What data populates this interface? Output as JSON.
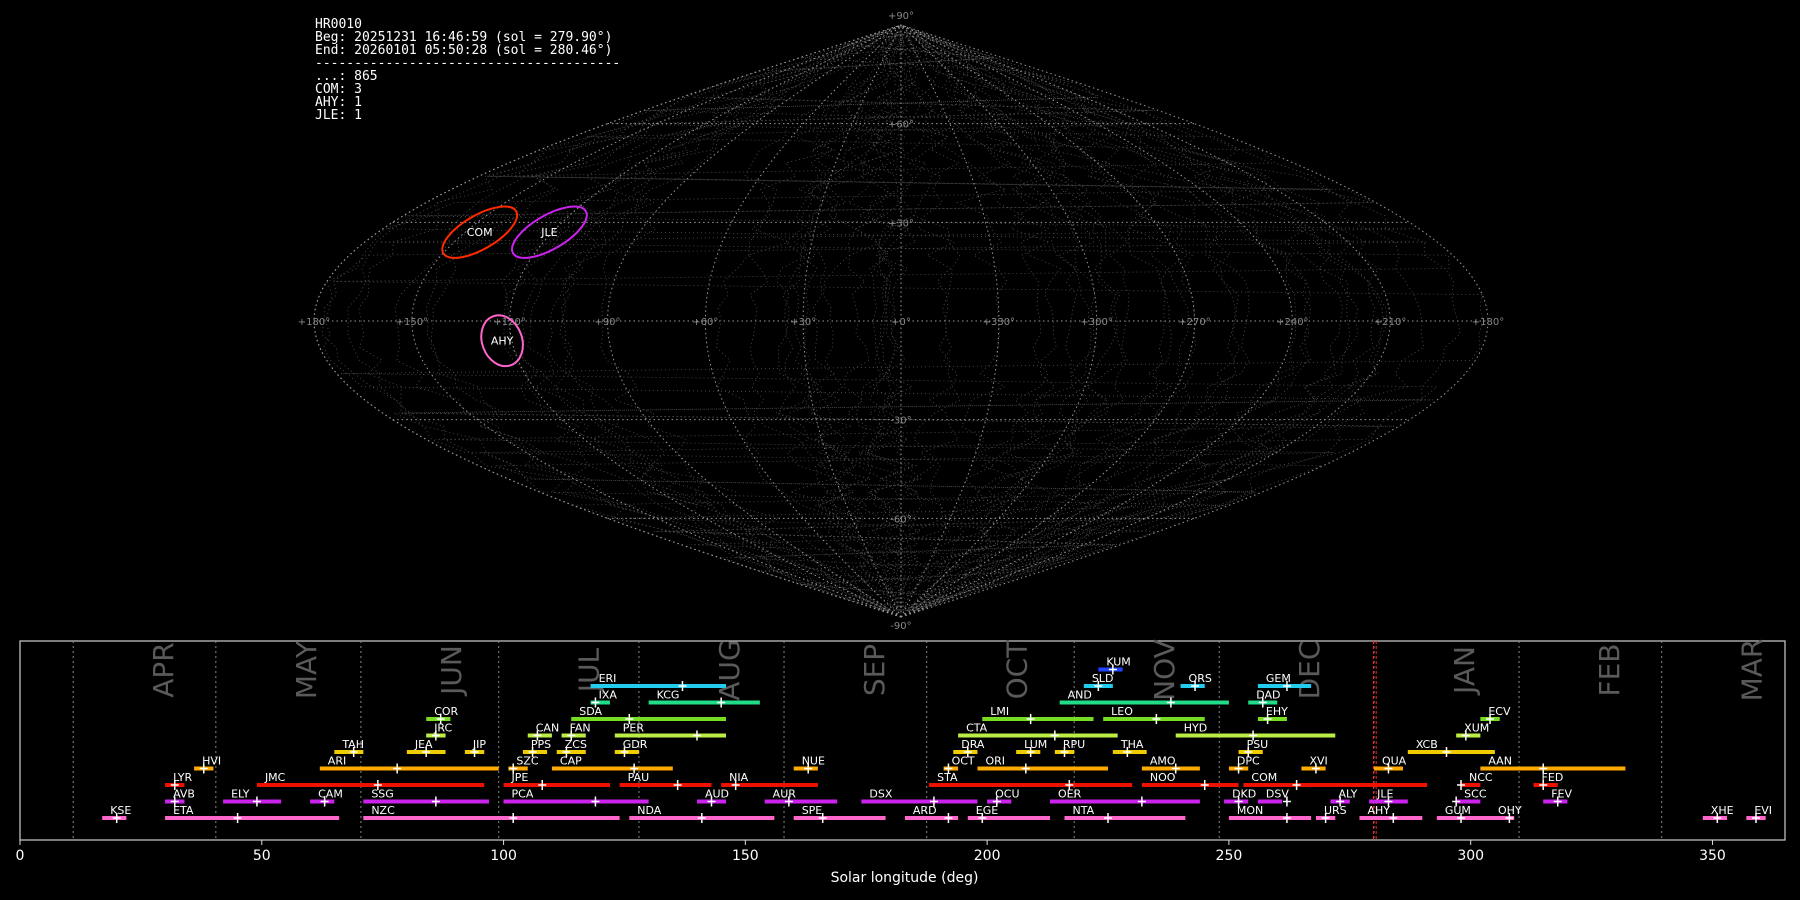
{
  "info": {
    "lines": [
      "HR0010",
      "Beg: 20251231 16:46:59 (sol = 279.90°)",
      "End: 20260101 05:50:28 (sol = 280.46°)",
      "---------------------------------------",
      "...: 865",
      "COM: 3",
      "AHY: 1",
      "JLE: 1"
    ]
  },
  "sky_map": {
    "projection": "sinusoidal",
    "lon_labels": [
      "+180°",
      "+150°",
      "+120°",
      "+90°",
      "+60°",
      "+30°",
      "+0°",
      "+330°",
      "+300°",
      "+270°",
      "+240°",
      "+210°",
      "+180°"
    ],
    "lat_labels": [
      "+90°",
      "+60°",
      "+30°",
      "-30°",
      "-60°",
      "-90°"
    ],
    "radiants": [
      {
        "code": "COM",
        "lon": 145,
        "lat": 27,
        "color": "#ff2a00"
      },
      {
        "code": "JLE",
        "lon": 121,
        "lat": 27,
        "color": "#cc22ee"
      },
      {
        "code": "AHY",
        "lon": 123,
        "lat": -6,
        "color": "#ff66cc"
      }
    ]
  },
  "chart_data": {
    "type": "timeline",
    "xlabel": "Solar longitude (deg)",
    "xlim": [
      0,
      365
    ],
    "x_ticks": [
      0,
      50,
      100,
      150,
      200,
      250,
      300,
      350
    ],
    "months": [
      {
        "name": "APR",
        "start": 11
      },
      {
        "name": "MAY",
        "start": 40.5
      },
      {
        "name": "JUN",
        "start": 70.5
      },
      {
        "name": "JUL",
        "start": 99
      },
      {
        "name": "AUG",
        "start": 128
      },
      {
        "name": "SEP",
        "start": 158
      },
      {
        "name": "OCT",
        "start": 187.5
      },
      {
        "name": "NOV",
        "start": 218
      },
      {
        "name": "DEC",
        "start": 248
      },
      {
        "name": "JAN",
        "start": 280
      },
      {
        "name": "FEB",
        "start": 310
      },
      {
        "name": "MAR",
        "start": 339.5
      }
    ],
    "current_sol": [
      279.9,
      280.46
    ],
    "showers": [
      {
        "code": "KSE",
        "start": 17,
        "end": 22,
        "peak": 20,
        "row": 0,
        "color": "#ff66cc"
      },
      {
        "code": "ETA",
        "start": 30,
        "end": 66,
        "peak": 45,
        "row": 0,
        "color": "#ff66cc"
      },
      {
        "code": "NZC",
        "start": 71,
        "end": 124,
        "peak": 102,
        "row": 0,
        "color": "#ff66cc"
      },
      {
        "code": "NDA",
        "start": 126,
        "end": 156,
        "peak": 141,
        "row": 0,
        "color": "#ff66cc"
      },
      {
        "code": "SPE",
        "start": 160,
        "end": 179,
        "peak": 166,
        "row": 0,
        "color": "#ff66cc"
      },
      {
        "code": "ARD",
        "start": 183,
        "end": 194,
        "peak": 192,
        "row": 0,
        "color": "#ff66cc"
      },
      {
        "code": "EGE",
        "start": 196,
        "end": 213,
        "peak": 199,
        "row": 0,
        "color": "#ff66cc"
      },
      {
        "code": "NTA",
        "start": 216,
        "end": 241,
        "peak": 225,
        "row": 0,
        "color": "#ff66cc"
      },
      {
        "code": "MON",
        "start": 250,
        "end": 267,
        "peak": 262,
        "row": 0,
        "color": "#ff66cc"
      },
      {
        "code": "URS",
        "start": 268,
        "end": 272,
        "peak": 270,
        "row": 0,
        "color": "#ff66cc"
      },
      {
        "code": "AHY",
        "start": 277,
        "end": 290,
        "peak": 284,
        "row": 0,
        "color": "#ff66cc"
      },
      {
        "code": "GUM",
        "start": 293,
        "end": 304,
        "peak": 298,
        "row": 0,
        "color": "#ff66cc"
      },
      {
        "code": "OHY",
        "start": 304,
        "end": 309,
        "peak": 308,
        "row": 0,
        "color": "#ff66cc"
      },
      {
        "code": "XHE",
        "start": 348,
        "end": 353,
        "peak": 351,
        "row": 0,
        "color": "#ff66cc"
      },
      {
        "code": "EVI",
        "start": 357,
        "end": 361,
        "peak": 359,
        "row": 0,
        "color": "#ff66cc"
      },
      {
        "code": "AVB",
        "start": 30,
        "end": 34,
        "peak": 32,
        "row": 1,
        "color": "#cc22ee"
      },
      {
        "code": "ELY",
        "start": 42,
        "end": 54,
        "peak": 49,
        "row": 1,
        "color": "#cc22ee"
      },
      {
        "code": "CAM",
        "start": 60,
        "end": 65,
        "peak": 63,
        "row": 1,
        "color": "#cc22ee"
      },
      {
        "code": "SSG",
        "start": 71,
        "end": 97,
        "peak": 86,
        "row": 1,
        "color": "#cc22ee"
      },
      {
        "code": "PCA",
        "start": 100,
        "end": 130,
        "peak": 119,
        "row": 1,
        "color": "#cc22ee"
      },
      {
        "code": "AUD",
        "start": 140,
        "end": 146,
        "peak": 143,
        "row": 1,
        "color": "#cc22ee"
      },
      {
        "code": "AUR",
        "start": 154,
        "end": 169,
        "peak": 159,
        "row": 1,
        "color": "#cc22ee"
      },
      {
        "code": "DSX",
        "start": 174,
        "end": 198,
        "peak": 189,
        "row": 1,
        "color": "#cc22ee"
      },
      {
        "code": "OCU",
        "start": 200,
        "end": 205,
        "peak": 202,
        "row": 1,
        "color": "#cc22ee"
      },
      {
        "code": "OER",
        "start": 213,
        "end": 244,
        "peak": 232,
        "row": 1,
        "color": "#cc22ee"
      },
      {
        "code": "DKD",
        "start": 249,
        "end": 254,
        "peak": 252,
        "row": 1,
        "color": "#cc22ee"
      },
      {
        "code": "DSV",
        "start": 256,
        "end": 261,
        "peak": 262,
        "row": 1,
        "color": "#cc22ee"
      },
      {
        "code": "ALY",
        "start": 271,
        "end": 275,
        "peak": 273,
        "row": 1,
        "color": "#cc22ee"
      },
      {
        "code": "JLE",
        "start": 279,
        "end": 287,
        "peak": 283,
        "row": 1,
        "color": "#cc22ee"
      },
      {
        "code": "SCC",
        "start": 297,
        "end": 302,
        "peak": 297,
        "row": 1,
        "color": "#cc22ee"
      },
      {
        "code": "FEV",
        "start": 315,
        "end": 320,
        "peak": 318,
        "row": 1,
        "color": "#cc22ee"
      },
      {
        "code": "LYR",
        "start": 30,
        "end": 34,
        "peak": 32,
        "row": 2,
        "color": "#ee1100"
      },
      {
        "code": "JMC",
        "start": 49,
        "end": 96,
        "peak": 74,
        "row": 2,
        "color": "#ee1100"
      },
      {
        "code": "JPE",
        "start": 100,
        "end": 122,
        "peak": 108,
        "row": 2,
        "color": "#ee1100"
      },
      {
        "code": "PAU",
        "start": 124,
        "end": 143,
        "peak": 136,
        "row": 2,
        "color": "#ee1100"
      },
      {
        "code": "NIA",
        "start": 145,
        "end": 165,
        "peak": 148,
        "row": 2,
        "color": "#ee1100"
      },
      {
        "code": "STA",
        "start": 188,
        "end": 230,
        "peak": 217,
        "row": 2,
        "color": "#ee1100"
      },
      {
        "code": "NOO",
        "start": 232,
        "end": 252,
        "peak": 245,
        "row": 2,
        "color": "#ee1100"
      },
      {
        "code": "COM",
        "start": 253,
        "end": 291,
        "peak": 264,
        "row": 2,
        "color": "#ee1100"
      },
      {
        "code": "NCC",
        "start": 298,
        "end": 302,
        "peak": 298,
        "row": 2,
        "color": "#ee1100"
      },
      {
        "code": "FED",
        "start": 313,
        "end": 318,
        "peak": 315,
        "row": 2,
        "color": "#ee1100"
      },
      {
        "code": "HVI",
        "start": 36,
        "end": 40,
        "peak": 38,
        "row": 3,
        "color": "#ffaa00"
      },
      {
        "code": "ARI",
        "start": 62,
        "end": 99,
        "peak": 78,
        "row": 3,
        "color": "#ffaa00"
      },
      {
        "code": "SZC",
        "start": 101,
        "end": 105,
        "peak": 102,
        "row": 3,
        "color": "#ffaa00"
      },
      {
        "code": "CAP",
        "start": 110,
        "end": 135,
        "peak": 127,
        "row": 3,
        "color": "#ffaa00"
      },
      {
        "code": "NUE",
        "start": 160,
        "end": 165,
        "peak": 163,
        "row": 3,
        "color": "#ffaa00"
      },
      {
        "code": "OCT",
        "start": 191,
        "end": 194,
        "peak": 192,
        "row": 3,
        "color": "#ffaa00"
      },
      {
        "code": "ORI",
        "start": 198,
        "end": 225,
        "peak": 208,
        "row": 3,
        "color": "#ffaa00"
      },
      {
        "code": "AMO",
        "start": 232,
        "end": 244,
        "peak": 239,
        "row": 3,
        "color": "#ffaa00"
      },
      {
        "code": "DPC",
        "start": 250,
        "end": 254,
        "peak": 252,
        "row": 3,
        "color": "#ffaa00"
      },
      {
        "code": "XVI",
        "start": 265,
        "end": 270,
        "peak": 268,
        "row": 3,
        "color": "#ffaa00"
      },
      {
        "code": "QUA",
        "start": 280,
        "end": 286,
        "peak": 283,
        "row": 3,
        "color": "#ffaa00"
      },
      {
        "code": "AAN",
        "start": 302,
        "end": 332,
        "peak": 315,
        "row": 3,
        "color": "#ffaa00"
      },
      {
        "code": "TAH",
        "start": 65,
        "end": 71,
        "peak": 69,
        "row": 4,
        "color": "#eecc00"
      },
      {
        "code": "JEA",
        "start": 80,
        "end": 88,
        "peak": 84,
        "row": 4,
        "color": "#eecc00"
      },
      {
        "code": "JIP",
        "start": 92,
        "end": 96,
        "peak": 94,
        "row": 4,
        "color": "#eecc00"
      },
      {
        "code": "PPS",
        "start": 104,
        "end": 109,
        "peak": 106,
        "row": 4,
        "color": "#eecc00"
      },
      {
        "code": "ZCS",
        "start": 111,
        "end": 117,
        "peak": 113,
        "row": 4,
        "color": "#eecc00"
      },
      {
        "code": "GDR",
        "start": 123,
        "end": 128,
        "peak": 125,
        "row": 4,
        "color": "#eecc00"
      },
      {
        "code": "DRA",
        "start": 193,
        "end": 198,
        "peak": 196,
        "row": 4,
        "color": "#eecc00"
      },
      {
        "code": "LUM",
        "start": 206,
        "end": 211,
        "peak": 209,
        "row": 4,
        "color": "#eecc00"
      },
      {
        "code": "RPU",
        "start": 214,
        "end": 218,
        "peak": 216,
        "row": 4,
        "color": "#eecc00"
      },
      {
        "code": "THA",
        "start": 226,
        "end": 233,
        "peak": 229,
        "row": 4,
        "color": "#eecc00"
      },
      {
        "code": "PSU",
        "start": 252,
        "end": 257,
        "peak": 254,
        "row": 4,
        "color": "#eecc00"
      },
      {
        "code": "XCB",
        "start": 287,
        "end": 305,
        "peak": 295,
        "row": 4,
        "color": "#eecc00"
      },
      {
        "code": "JRC",
        "start": 84,
        "end": 88,
        "peak": 86,
        "row": 5,
        "color": "#bbee44"
      },
      {
        "code": "CAN",
        "start": 105,
        "end": 110,
        "peak": 107,
        "row": 5,
        "color": "#bbee44"
      },
      {
        "code": "FAN",
        "start": 112,
        "end": 117,
        "peak": 114,
        "row": 5,
        "color": "#bbee44"
      },
      {
        "code": "PER",
        "start": 123,
        "end": 146,
        "peak": 140,
        "row": 5,
        "color": "#bbee44"
      },
      {
        "code": "CTA",
        "start": 194,
        "end": 227,
        "peak": 214,
        "row": 5,
        "color": "#bbee44"
      },
      {
        "code": "HYD",
        "start": 239,
        "end": 272,
        "peak": 255,
        "row": 5,
        "color": "#bbee44"
      },
      {
        "code": "XUM",
        "start": 297,
        "end": 302,
        "peak": 299,
        "row": 5,
        "color": "#bbee44"
      },
      {
        "code": "COR",
        "start": 84,
        "end": 89,
        "peak": 87,
        "row": 6,
        "color": "#77dd22"
      },
      {
        "code": "SDA",
        "start": 114,
        "end": 146,
        "peak": 126,
        "row": 6,
        "color": "#77dd22"
      },
      {
        "code": "LMI",
        "start": 199,
        "end": 222,
        "peak": 209,
        "row": 6,
        "color": "#77dd22"
      },
      {
        "code": "LEO",
        "start": 224,
        "end": 245,
        "peak": 235,
        "row": 6,
        "color": "#77dd22"
      },
      {
        "code": "EHY",
        "start": 256,
        "end": 262,
        "peak": 258,
        "row": 6,
        "color": "#77dd22"
      },
      {
        "code": "ECV",
        "start": 302,
        "end": 306,
        "peak": 304,
        "row": 6,
        "color": "#77dd22"
      },
      {
        "code": "IXA",
        "start": 118,
        "end": 122,
        "peak": 119,
        "row": 7,
        "color": "#22dd88"
      },
      {
        "code": "KCG",
        "start": 130,
        "end": 153,
        "peak": 145,
        "row": 7,
        "color": "#22dd88"
      },
      {
        "code": "AND",
        "start": 215,
        "end": 250,
        "peak": 238,
        "row": 7,
        "color": "#22dd88"
      },
      {
        "code": "DAD",
        "start": 254,
        "end": 260,
        "peak": 257,
        "row": 7,
        "color": "#22dd88"
      },
      {
        "code": "ERI",
        "start": 118,
        "end": 146,
        "peak": 137,
        "row": 8,
        "color": "#22ccee"
      },
      {
        "code": "SLD",
        "start": 220,
        "end": 226,
        "peak": 223,
        "row": 8,
        "color": "#22ccee"
      },
      {
        "code": "ORS",
        "start": 240,
        "end": 245,
        "peak": 243,
        "row": 8,
        "color": "#22ccee"
      },
      {
        "code": "GEM",
        "start": 256,
        "end": 267,
        "peak": 262,
        "row": 8,
        "color": "#22ccee"
      },
      {
        "code": "KUM",
        "start": 223,
        "end": 228,
        "peak": 226,
        "row": 9,
        "color": "#2244ff"
      }
    ]
  }
}
